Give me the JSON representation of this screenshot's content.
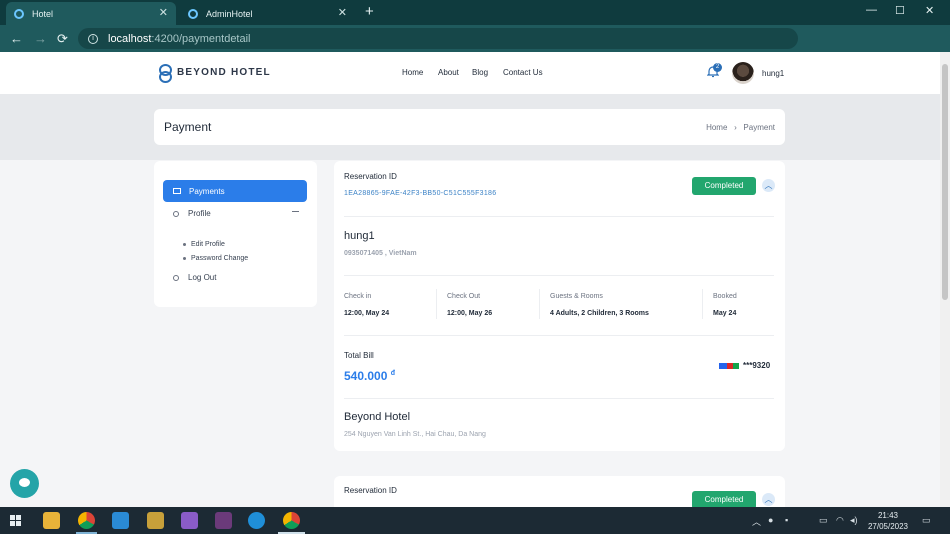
{
  "browser": {
    "tabs": [
      {
        "title": "Hotel",
        "active": true
      },
      {
        "title": "AdminHotel",
        "active": false
      }
    ],
    "new_tab": "+",
    "url_host": "localhost",
    "url_rest": ":4200/paymentdetail",
    "controls": {
      "minimize": "—",
      "maximize": "☐",
      "close": "✕"
    },
    "nav": {
      "back": "←",
      "forward": "→",
      "reload": "⟳"
    }
  },
  "site": {
    "brand": "BEYOND HOTEL",
    "menu": [
      "Home",
      "About",
      "Blog",
      "Contact Us"
    ],
    "notification_count": "2",
    "username": "hung1"
  },
  "page": {
    "title": "Payment",
    "breadcrumb": {
      "home": "Home",
      "sep": "›",
      "current": "Payment"
    }
  },
  "sidebar": {
    "payments": "Payments",
    "profile": "Profile",
    "profile_sub": [
      "Edit Profile",
      "Password Change"
    ],
    "logout": "Log Out"
  },
  "reservation": {
    "id_label": "Reservation ID",
    "id_value": "1EA28865-9FAE-42F3-BB50-C51C555F3186",
    "status": "Completed",
    "guest_name": "hung1",
    "guest_contact": "0935071405 , VietNam",
    "checkin_label": "Check in",
    "checkin_value": "12:00, May 24",
    "checkout_label": "Check Out",
    "checkout_value": "12:00, May 26",
    "guests_label": "Guests & Rooms",
    "guests_value": "4 Adults, 2 Children, 3 Rooms",
    "booked_label": "Booked",
    "booked_value": "May 24",
    "total_label": "Total Bill",
    "total_value": "540.000",
    "currency": "đ",
    "card_masked": "***9320",
    "hotel_name": "Beyond Hotel",
    "hotel_address": "254 Nguyen Van Linh St., Hai Chau, Da Nang"
  },
  "reservation2": {
    "id_label": "Reservation ID",
    "status": "Completed"
  },
  "taskbar": {
    "time": "21:43",
    "date": "27/05/2023"
  },
  "colors": {
    "accent": "#2b7de9",
    "status_green": "#22a66e",
    "chrome": "#0f3b3e"
  }
}
